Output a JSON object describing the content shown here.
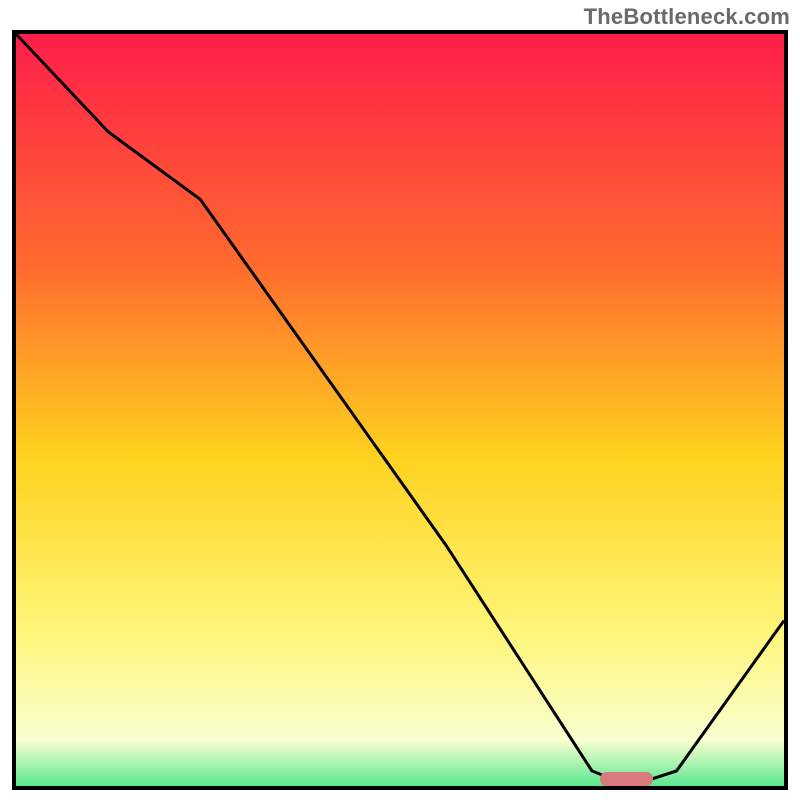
{
  "watermark": "TheBottleneck.com",
  "colors": {
    "frame": "#000000",
    "curve": "#000000",
    "marker": "#d97a7f",
    "grad_top": "#ff1e4a",
    "grad_mid1": "#ff6a2e",
    "grad_mid2": "#ffd21e",
    "grad_mid3": "#fff67a",
    "grad_mid4": "#f9ffd0",
    "grad_bottom": "#24e07a"
  },
  "chart_data": {
    "type": "line",
    "title": "",
    "xlabel": "",
    "ylabel": "",
    "xlim": [
      0,
      100
    ],
    "ylim": [
      0,
      100
    ],
    "legend": false,
    "grid": false,
    "series": [
      {
        "name": "bottleneck-curve",
        "x": [
          0,
          12,
          24,
          56,
          75,
          80,
          86,
          100
        ],
        "y": [
          100,
          87,
          78,
          32,
          2,
          0,
          2,
          22
        ]
      }
    ],
    "annotations": [
      {
        "name": "optimal-range-marker",
        "x_start": 76,
        "x_end": 83,
        "y": 0
      }
    ],
    "background_gradient_note": "vertical red→orange→yellow→pale→green maps roughly to y 100→0"
  }
}
